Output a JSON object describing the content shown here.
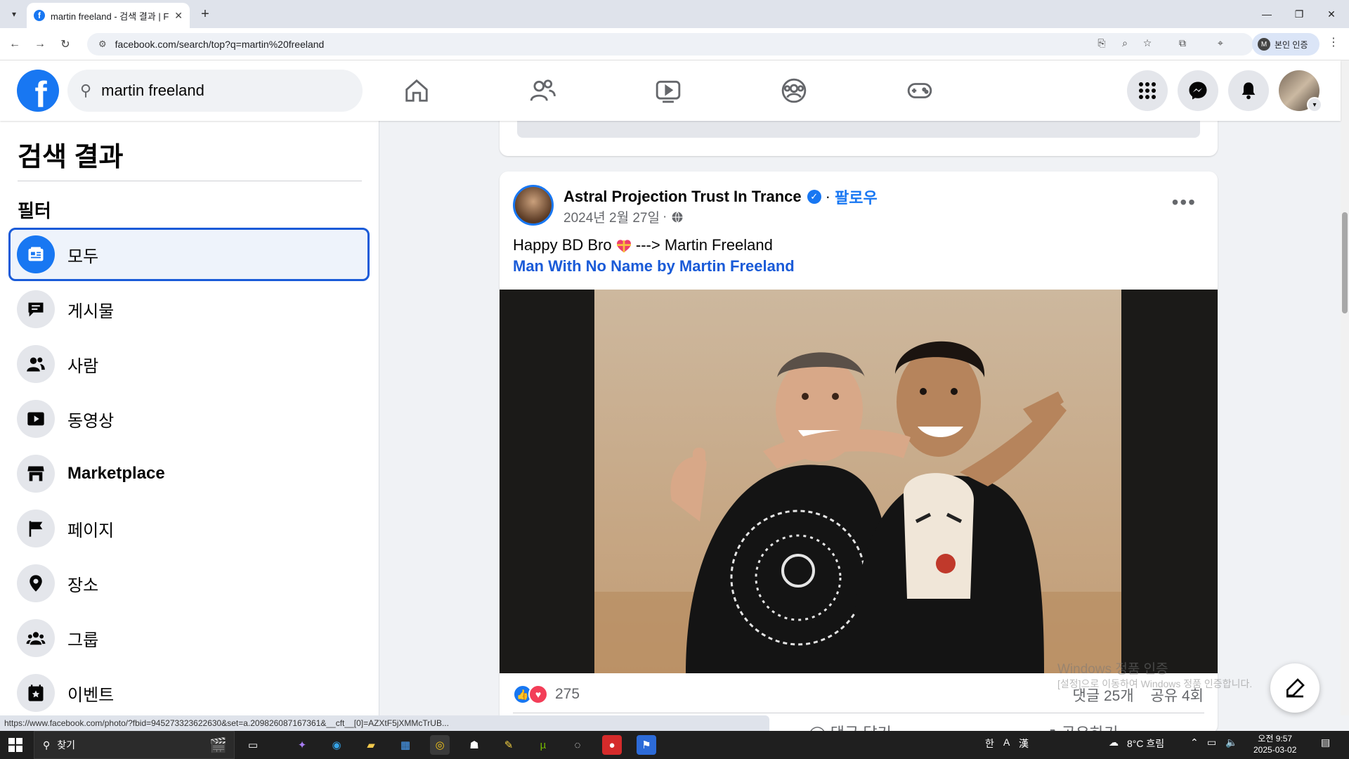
{
  "browser": {
    "tab_title": "martin freeland - 검색 결과 | F",
    "url": "facebook.com/search/top?q=martin%20freeland",
    "profile_pill": "본인 인증",
    "profile_initial": "M",
    "status_url": "https://www.facebook.com/photo/?fbid=945273323622630&set=a.209826087167361&__cft__[0]=AZXtF5jXMMcTrUB..."
  },
  "fb": {
    "search_value": "martin freeland",
    "logo_letter": "f"
  },
  "sidebar": {
    "title": "검색 결과",
    "filter_heading": "필터",
    "items": [
      {
        "label": "모두",
        "icon": "all-results-icon"
      },
      {
        "label": "게시물",
        "icon": "posts-icon"
      },
      {
        "label": "사람",
        "icon": "people-icon"
      },
      {
        "label": "동영상",
        "icon": "video-icon"
      },
      {
        "label": "Marketplace",
        "icon": "marketplace-icon"
      },
      {
        "label": "페이지",
        "icon": "flag-icon"
      },
      {
        "label": "장소",
        "icon": "location-pin-icon"
      },
      {
        "label": "그룹",
        "icon": "groups-icon"
      },
      {
        "label": "이벤트",
        "icon": "event-icon"
      }
    ]
  },
  "post": {
    "author": "Astral Projection Trust In Trance",
    "separator": "·",
    "follow": "팔로우",
    "date": "2024년 2월 27일",
    "text_before": "Happy BD Bro",
    "text_after": "---> Martin Freeland",
    "link": "Man With No Name by Martin Freeland",
    "reaction_count": "275",
    "comments": "댓글 25개",
    "shares": "공유 4회",
    "action_comment": "댓글 달기",
    "action_share": "공유하기"
  },
  "watermark": {
    "line1": "Windows 정품 인증",
    "line2": "[설정]으로 이동하여 Windows 정품 인증합니다."
  },
  "taskbar": {
    "search_label": "찾기",
    "ime": "漢",
    "ime2": "A",
    "weather": "8°C 흐림",
    "time": "오전 9:57",
    "date": "2025-03-02"
  },
  "colors": {
    "fb_blue": "#1877f2",
    "link_blue": "#1a5bd8",
    "love_red": "#f33e58"
  }
}
